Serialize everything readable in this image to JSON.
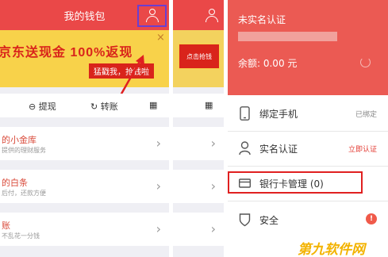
{
  "wallet": {
    "title": "我的钱包",
    "banner": {
      "headline": "京东送现金 100%返现",
      "button": "猛戳我，抢钱啦",
      "close": "×"
    },
    "actions": [
      {
        "icon": "withdraw-icon",
        "label": "提现"
      },
      {
        "icon": "transfer-icon",
        "label": "转账"
      }
    ],
    "list": [
      {
        "title": "的小金库",
        "subtitle": "提供的理财服务"
      },
      {
        "title": "的白条",
        "subtitle": "后付，还款方便"
      },
      {
        "title": "账",
        "subtitle": "不乱花一分钱"
      }
    ]
  },
  "middle": {
    "banner_button": "点击抢钱"
  },
  "account": {
    "name": "未实名认证",
    "balance": "余额: 0.00 元",
    "menu": [
      {
        "icon": "phone-icon",
        "label": "绑定手机",
        "status": "已绑定"
      },
      {
        "icon": "user-icon",
        "label": "实名认证",
        "status": "立即认证"
      },
      {
        "icon": "bank-card-icon",
        "label": "银行卡管理",
        "count": "(0)"
      },
      {
        "icon": "shield-icon",
        "label": "安全",
        "badge": "!"
      }
    ]
  },
  "watermark": "第九软件网",
  "colors": {
    "accent_red": "#ea4848",
    "profile_red": "#eb5a53",
    "banner_yellow": "#f8d24a",
    "highlight_purple": "#6b3fd1",
    "highlight_red": "#e02020"
  }
}
